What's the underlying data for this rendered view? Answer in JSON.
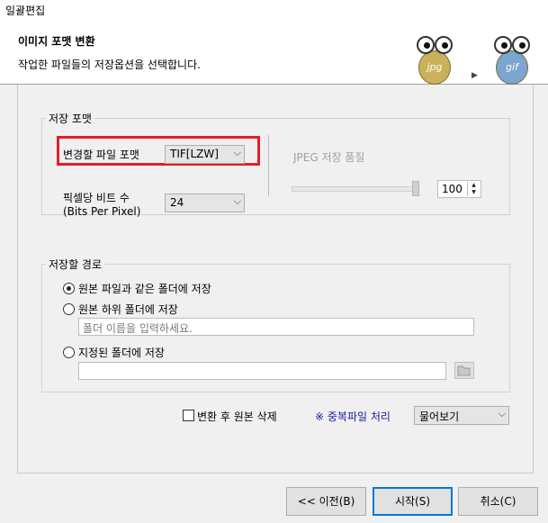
{
  "window": {
    "title": "일괄편집"
  },
  "header": {
    "title": "이미지 포맷 변환",
    "subtitle": "작업한 파일들의 저장옵션을 선택합니다.",
    "from_format": "jpg",
    "to_format": "gif",
    "arrow_icon": "triangle-right-icon"
  },
  "save_format": {
    "group_title": "저장 포맷",
    "format_label": "변경할 파일 포맷",
    "format_value": "TIF[LZW]",
    "bpp_label_line1": "픽셀당 비트 수",
    "bpp_label_line2": "(Bits Per Pixel)",
    "bpp_value": "24",
    "jpeg_quality_label": "JPEG 저장 품질",
    "jpeg_quality_value": "100",
    "jpeg_quality_fraction": 1.0,
    "highlight_color": "#e51e24"
  },
  "save_path": {
    "group_title": "저장할 경로",
    "option_same_folder": "원본 파일과 같은 폴더에 저장",
    "option_sub_folder": "원본 하위 폴더에 저장",
    "sub_folder_placeholder": "폴더 이름을 입력하세요.",
    "option_specified_folder": "지정된 폴더에 저장",
    "specified_folder_value": "",
    "selected_option": "same_folder"
  },
  "options": {
    "delete_original_label": "변환 후 원본 삭제",
    "delete_original_checked": false,
    "duplicate_label": "※ 중복파일 처리",
    "duplicate_value": "물어보기"
  },
  "buttons": {
    "prev": "<< 이전(B)",
    "start": "시작(S)",
    "cancel": "취소(C)"
  },
  "colors": {
    "accent": "#0078d7",
    "link": "#1a1aa6"
  }
}
